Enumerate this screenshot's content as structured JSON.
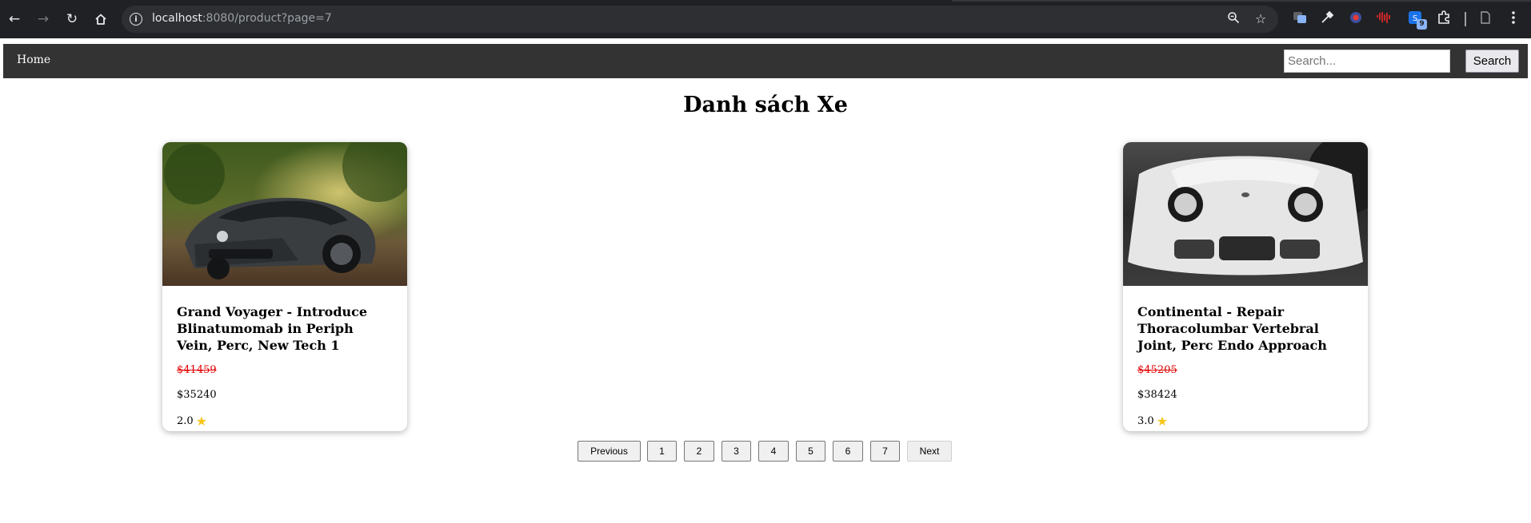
{
  "browser": {
    "url_host": "localhost",
    "url_rest": ":8080/product?page=7",
    "extension_badge": "9"
  },
  "navbar": {
    "home_label": "Home",
    "search_placeholder": "Search...",
    "search_button": "Search"
  },
  "page": {
    "title": "Danh sách Xe"
  },
  "products": [
    {
      "name": "Grand Voyager - Introduce Blinatumomab in Periph Vein, Perc, New Tech 1",
      "old_price": "$41459",
      "price": "$35240",
      "rating": "2.0"
    },
    {
      "name": "Continental - Repair Thoracolumbar Vertebral Joint, Perc Endo Approach",
      "old_price": "$45205",
      "price": "$38424",
      "rating": "3.0"
    }
  ],
  "pagination": {
    "previous": "Previous",
    "pages": [
      "1",
      "2",
      "3",
      "4",
      "5",
      "6",
      "7"
    ],
    "next": "Next"
  },
  "colors": {
    "navbar_bg": "#333333",
    "old_price": "#e00000",
    "star": "#f5c518"
  }
}
